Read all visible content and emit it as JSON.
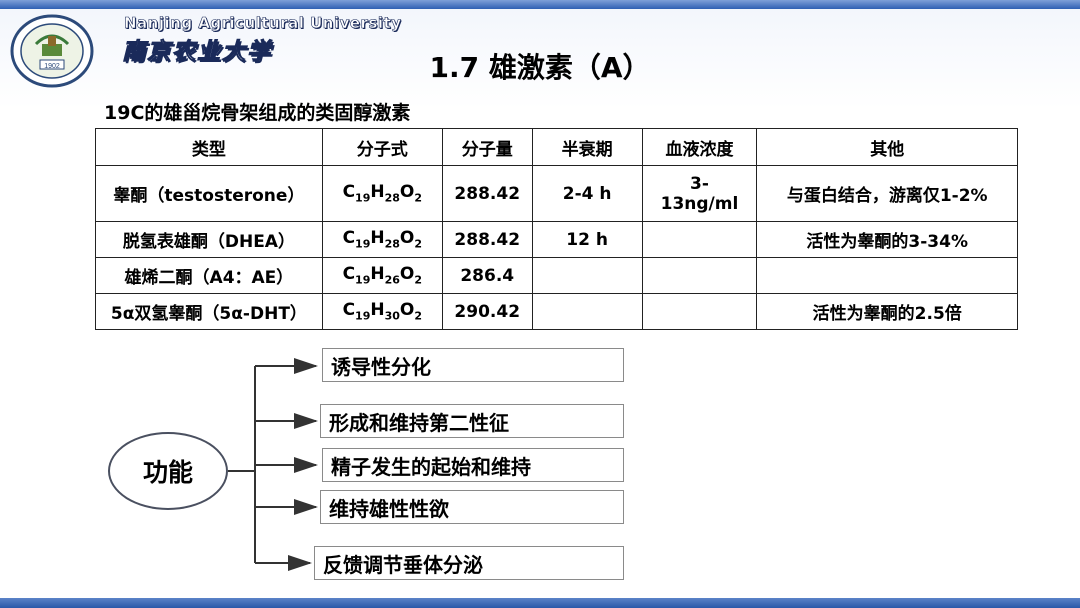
{
  "header": {
    "university_en": "Nanjing Agricultural University",
    "university_cn": "南京农业大学",
    "logo_year": "1902"
  },
  "slide": {
    "title": "1.7 雄激素（A）",
    "subtitle": "19C的雄甾烷骨架组成的类固醇激素"
  },
  "table": {
    "headers": [
      "类型",
      "分子式",
      "分子量",
      "半衰期",
      "血液浓度",
      "其他"
    ],
    "rows": [
      {
        "type": "睾酮（testosterone）",
        "formula": {
          "c": "19",
          "h": "28",
          "o": "2"
        },
        "mw": "288.42",
        "half_life": "2-4 h",
        "blood_line1": "3-",
        "blood_line2": "13ng/ml",
        "other": "与蛋白结合，游离仅1-2%"
      },
      {
        "type": "脱氢表雄酮（DHEA）",
        "formula": {
          "c": "19",
          "h": "28",
          "o": "2"
        },
        "mw": "288.42",
        "half_life": "12 h",
        "blood_line1": "",
        "blood_line2": "",
        "other": "活性为睾酮的3-34%"
      },
      {
        "type": "雄烯二酮（A4：AE）",
        "formula": {
          "c": "19",
          "h": "26",
          "o": "2"
        },
        "mw": "286.4",
        "half_life": "",
        "blood_line1": "",
        "blood_line2": "",
        "other": ""
      },
      {
        "type": "5α双氢睾酮（5α-DHT）",
        "formula": {
          "c": "19",
          "h": "30",
          "o": "2"
        },
        "mw": "290.42",
        "half_life": "",
        "blood_line1": "",
        "blood_line2": "",
        "other": "活性为睾酮的2.5倍"
      }
    ]
  },
  "functions": {
    "label": "功能",
    "items": [
      "诱导性分化",
      "形成和维持第二性征",
      "精子发生的起始和维持",
      "维持雄性性欲",
      "反馈调节垂体分泌"
    ]
  }
}
